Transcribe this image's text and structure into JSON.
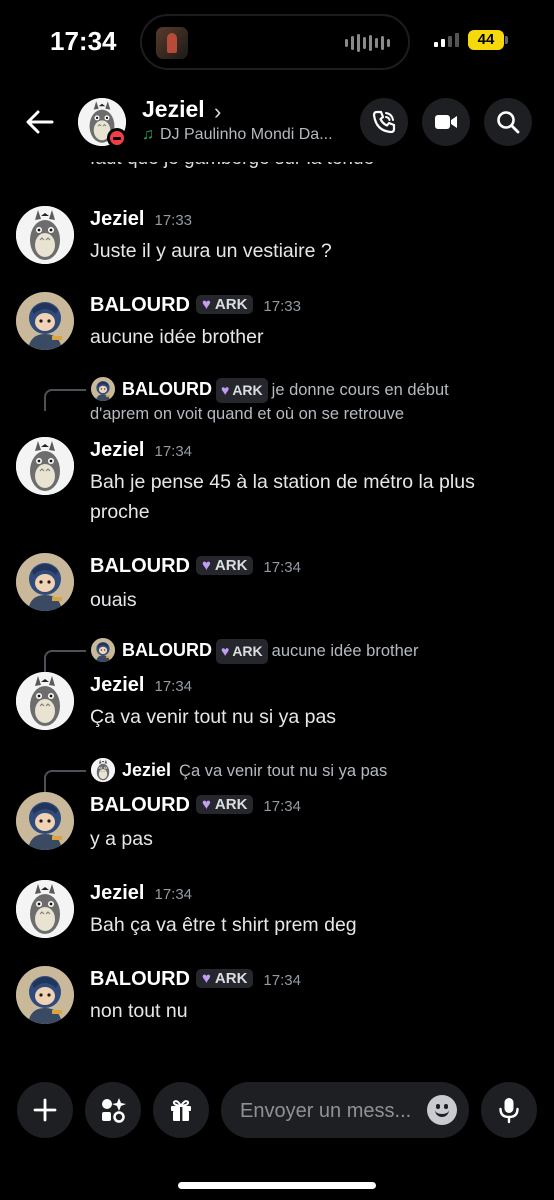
{
  "status_bar": {
    "time": "17:34",
    "battery": "44"
  },
  "header": {
    "name": "Jeziel",
    "chevron": "›",
    "activity": "DJ Paulinho Mondi Da...",
    "icons": [
      "back-arrow-icon",
      "phone-call-icon",
      "video-call-icon",
      "search-icon"
    ]
  },
  "feed": {
    "cut_text": "faut que je gamberge sur la tenue",
    "items": [
      {
        "author": "Jeziel",
        "time": "17:33",
        "text": "Juste il y aura un vestiaire ?"
      },
      {
        "author": "BALOURD",
        "tag": "ARK",
        "time": "17:33",
        "text": "aucune idée brother"
      },
      {
        "reply": {
          "author": "BALOURD",
          "tag": "ARK",
          "text_line1": "je donne cours en début",
          "text_line2": "d'aprem on voit quand et où on se retrouve"
        },
        "author": "Jeziel",
        "time": "17:34",
        "text_line1": "Bah je pense 45 à la station de métro la plus",
        "text_line2": "proche"
      },
      {
        "author": "BALOURD",
        "tag": "ARK",
        "time": "17:34",
        "text": "ouais"
      },
      {
        "reply": {
          "author": "BALOURD",
          "tag": "ARK",
          "text": "aucune idée brother"
        },
        "author": "Jeziel",
        "time": "17:34",
        "text": "Ça va venir tout nu si ya pas"
      },
      {
        "reply": {
          "author": "Jeziel",
          "text": "Ça va venir tout nu si ya pas"
        },
        "author": "BALOURD",
        "tag": "ARK",
        "time": "17:34",
        "text": "y a pas"
      },
      {
        "author": "Jeziel",
        "time": "17:34",
        "text": "Bah ça va être t shirt prem deg"
      },
      {
        "author": "BALOURD",
        "tag": "ARK",
        "time": "17:34",
        "text": "non tout nu"
      }
    ]
  },
  "composer": {
    "placeholder": "Envoyer un mess...",
    "icons": [
      "plus-icon",
      "apps-icon",
      "gift-icon",
      "emoji-icon",
      "microphone-icon"
    ]
  },
  "colors": {
    "background": "#000000",
    "dnd_status": "#f23f43",
    "tag_heart": "#c49cf4",
    "music_note": "#23a55a"
  }
}
